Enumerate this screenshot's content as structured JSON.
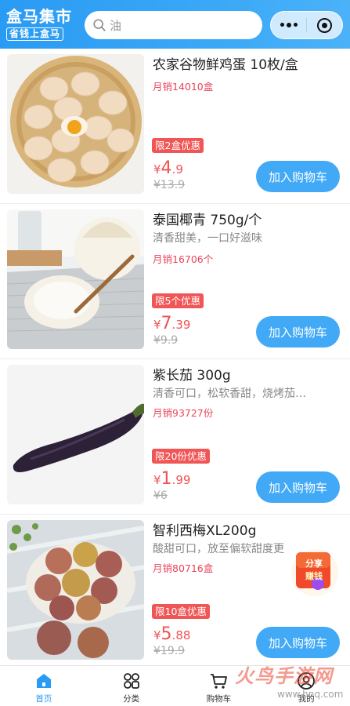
{
  "header": {
    "logo_top": "盒马集市",
    "logo_bottom": "省钱上盒马",
    "search_placeholder": "油",
    "icons": {
      "search": "search-icon",
      "more": "more-dots-icon",
      "close": "target-circle-icon"
    }
  },
  "products": [
    {
      "title": "农家谷物鲜鸡蛋 10枚/盒",
      "desc": "",
      "sales": "月销14010盒",
      "badge": "限2盒优惠",
      "price_yen": "¥",
      "price_int": "4",
      "price_dec": ".9",
      "original_price": "¥13.9",
      "button": "加入购物车"
    },
    {
      "title": "泰国椰青 750g/个",
      "desc": "清香甜美，一口好滋味",
      "sales": "月销16706个",
      "badge": "限5个优惠",
      "price_yen": "¥",
      "price_int": "7",
      "price_dec": ".39",
      "original_price": "¥9.9",
      "button": "加入购物车"
    },
    {
      "title": "紫长茄 300g",
      "desc": "清香可口，松软香甜，烧烤茄…",
      "sales": "月销93727份",
      "badge": "限20份优惠",
      "price_yen": "¥",
      "price_int": "1",
      "price_dec": ".99",
      "original_price": "¥6",
      "button": "加入购物车"
    },
    {
      "title": "智利西梅XL200g",
      "desc": "酸甜可口，放至偏软甜度更",
      "sales": "月销80716盒",
      "badge": "限10盒优惠",
      "price_yen": "¥",
      "price_int": "5",
      "price_dec": ".88",
      "original_price": "¥19.9",
      "button": "加入购物车"
    }
  ],
  "share_badge": {
    "line1": "分享",
    "line2": "赚钱"
  },
  "tabbar": [
    {
      "label": "首页",
      "icon": "home-icon",
      "active": true
    },
    {
      "label": "分类",
      "icon": "category-icon",
      "active": false
    },
    {
      "label": "购物车",
      "icon": "cart-icon",
      "active": false
    },
    {
      "label": "我的",
      "icon": "user-icon",
      "active": false
    }
  ],
  "watermark": {
    "main": "火鸟手游网",
    "sub": "www.hnq.com"
  },
  "colors": {
    "brand_blue": "#2a9bf3",
    "button_blue": "#41a9f6",
    "price_red": "#f05252",
    "badge_red": "#f15656"
  }
}
